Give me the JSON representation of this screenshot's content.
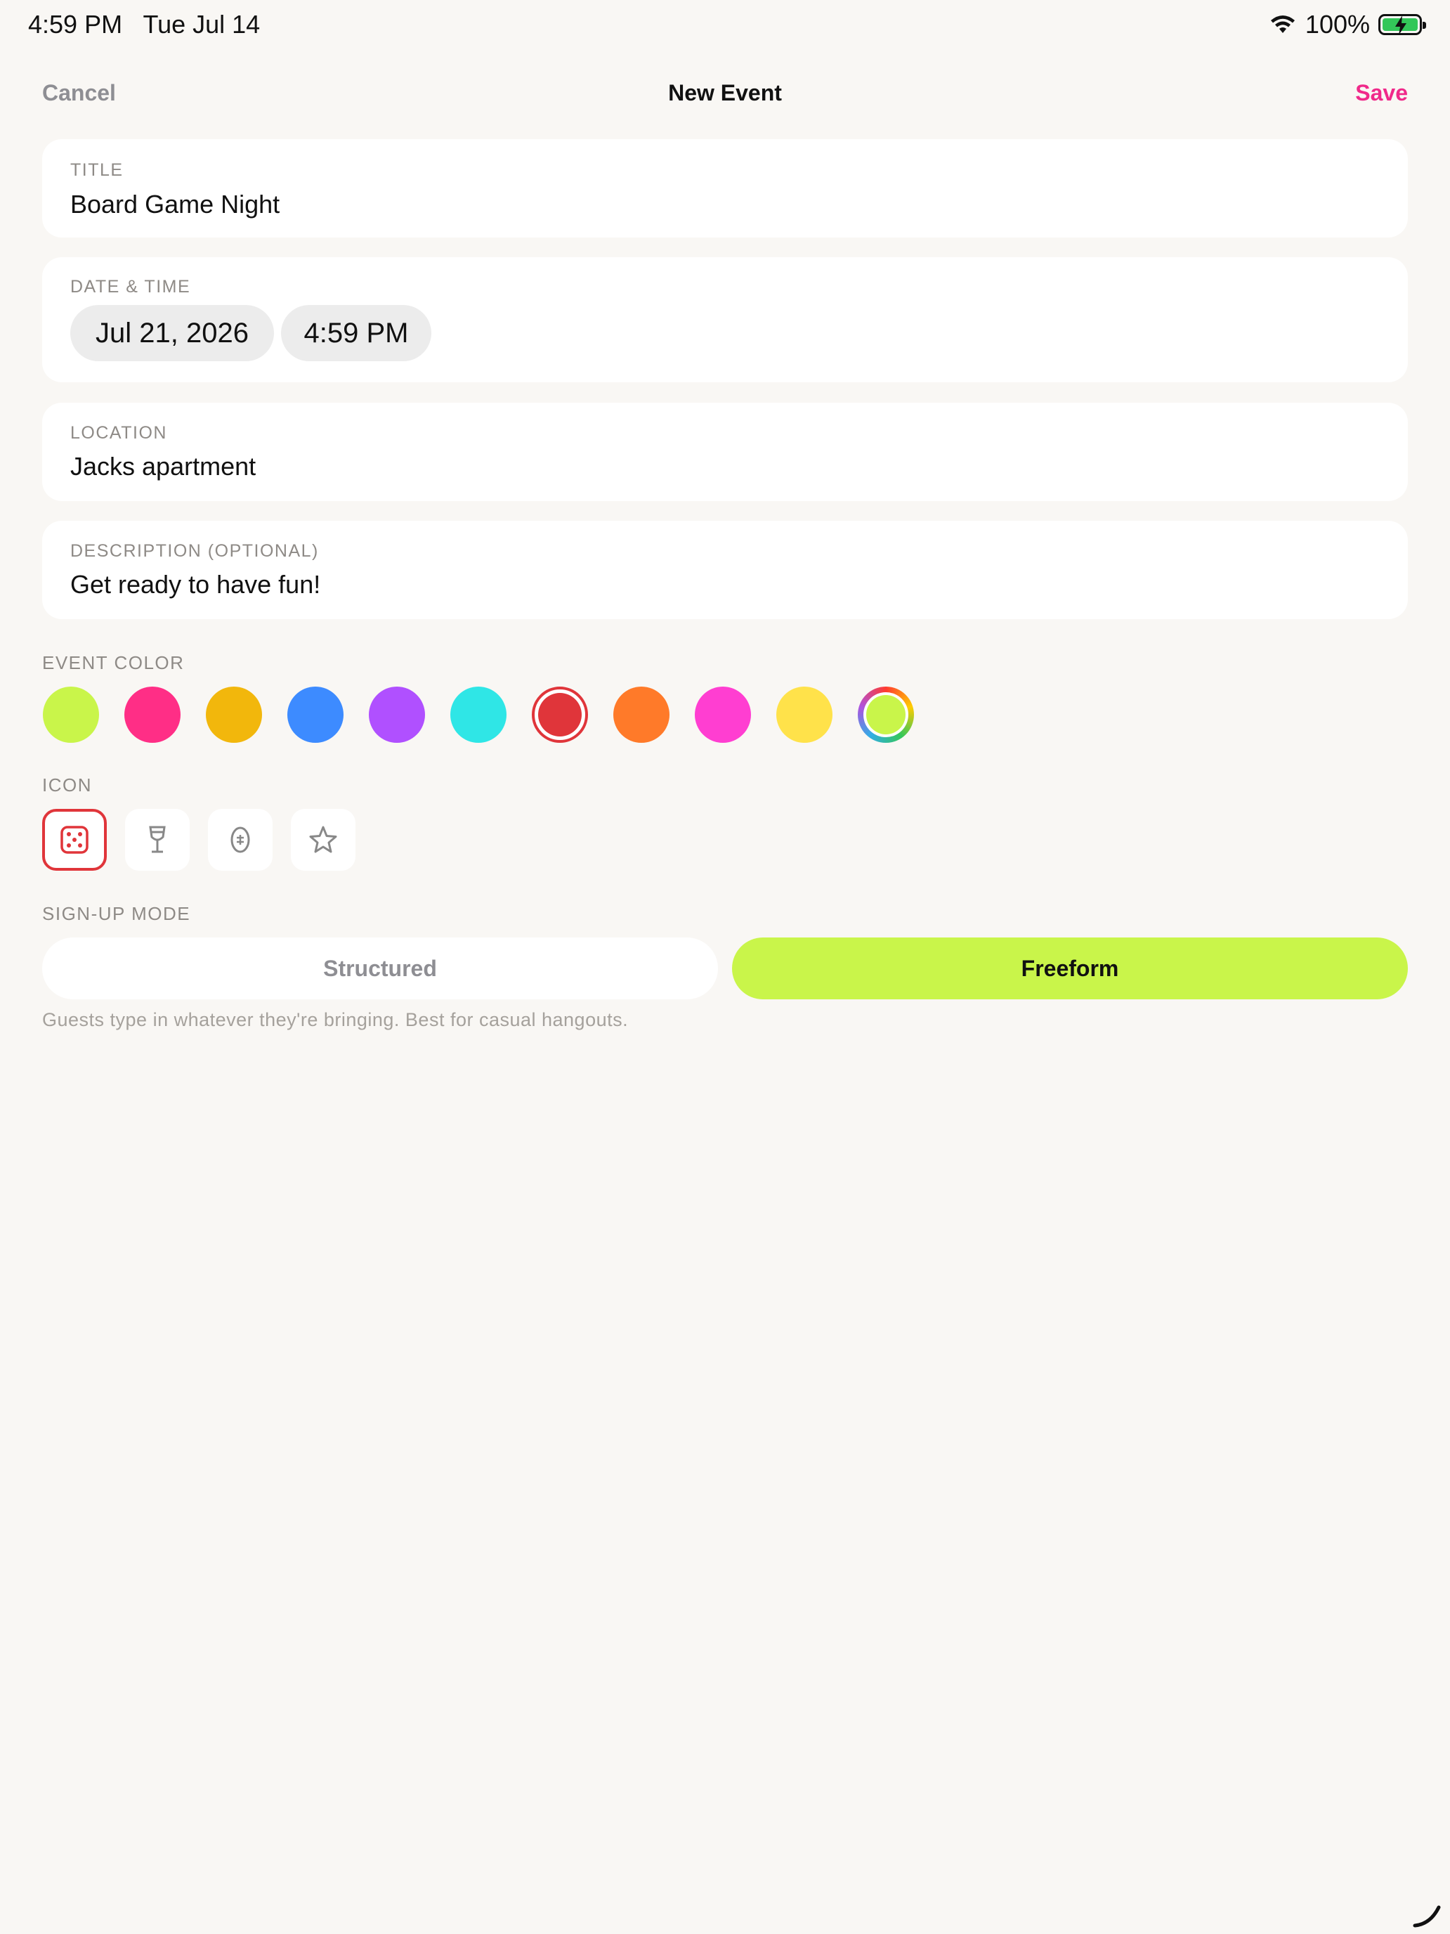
{
  "status_bar": {
    "time": "4:59 PM",
    "date": "Tue Jul 14",
    "battery_percent": "100%"
  },
  "nav": {
    "cancel": "Cancel",
    "title": "New Event",
    "save": "Save"
  },
  "title_field": {
    "label": "TITLE",
    "value": "Board Game Night"
  },
  "datetime_field": {
    "label": "DATE & TIME",
    "date": "Jul 21, 2026",
    "time": "4:59 PM"
  },
  "location_field": {
    "label": "LOCATION",
    "value": "Jacks apartment"
  },
  "description_field": {
    "label": "DESCRIPTION (OPTIONAL)",
    "value": "Get ready to have fun!"
  },
  "event_color": {
    "label": "EVENT COLOR",
    "swatches": [
      "#c9f54a",
      "#ff2e86",
      "#f2b70c",
      "#3d8bff",
      "#b050ff",
      "#2fe6e6",
      "#e0353a",
      "#ff7a29",
      "#ff3ed1",
      "#ffe24a",
      "custom"
    ],
    "selected_index": 6,
    "custom_swatch_color": "#c9f54a"
  },
  "icon": {
    "label": "ICON",
    "options": [
      "dice-icon",
      "wine-glass-icon",
      "football-icon",
      "star-icon"
    ],
    "selected_index": 0
  },
  "signup_mode": {
    "label": "SIGN-UP MODE",
    "options": [
      "Structured",
      "Freeform"
    ],
    "selected": "Freeform",
    "hint": "Guests type in whatever they're bringing. Best for casual hangouts."
  },
  "colors": {
    "accent_save": "#f0298a",
    "freeform_active": "#c9f54a",
    "selected_ring": "#e0353a"
  }
}
